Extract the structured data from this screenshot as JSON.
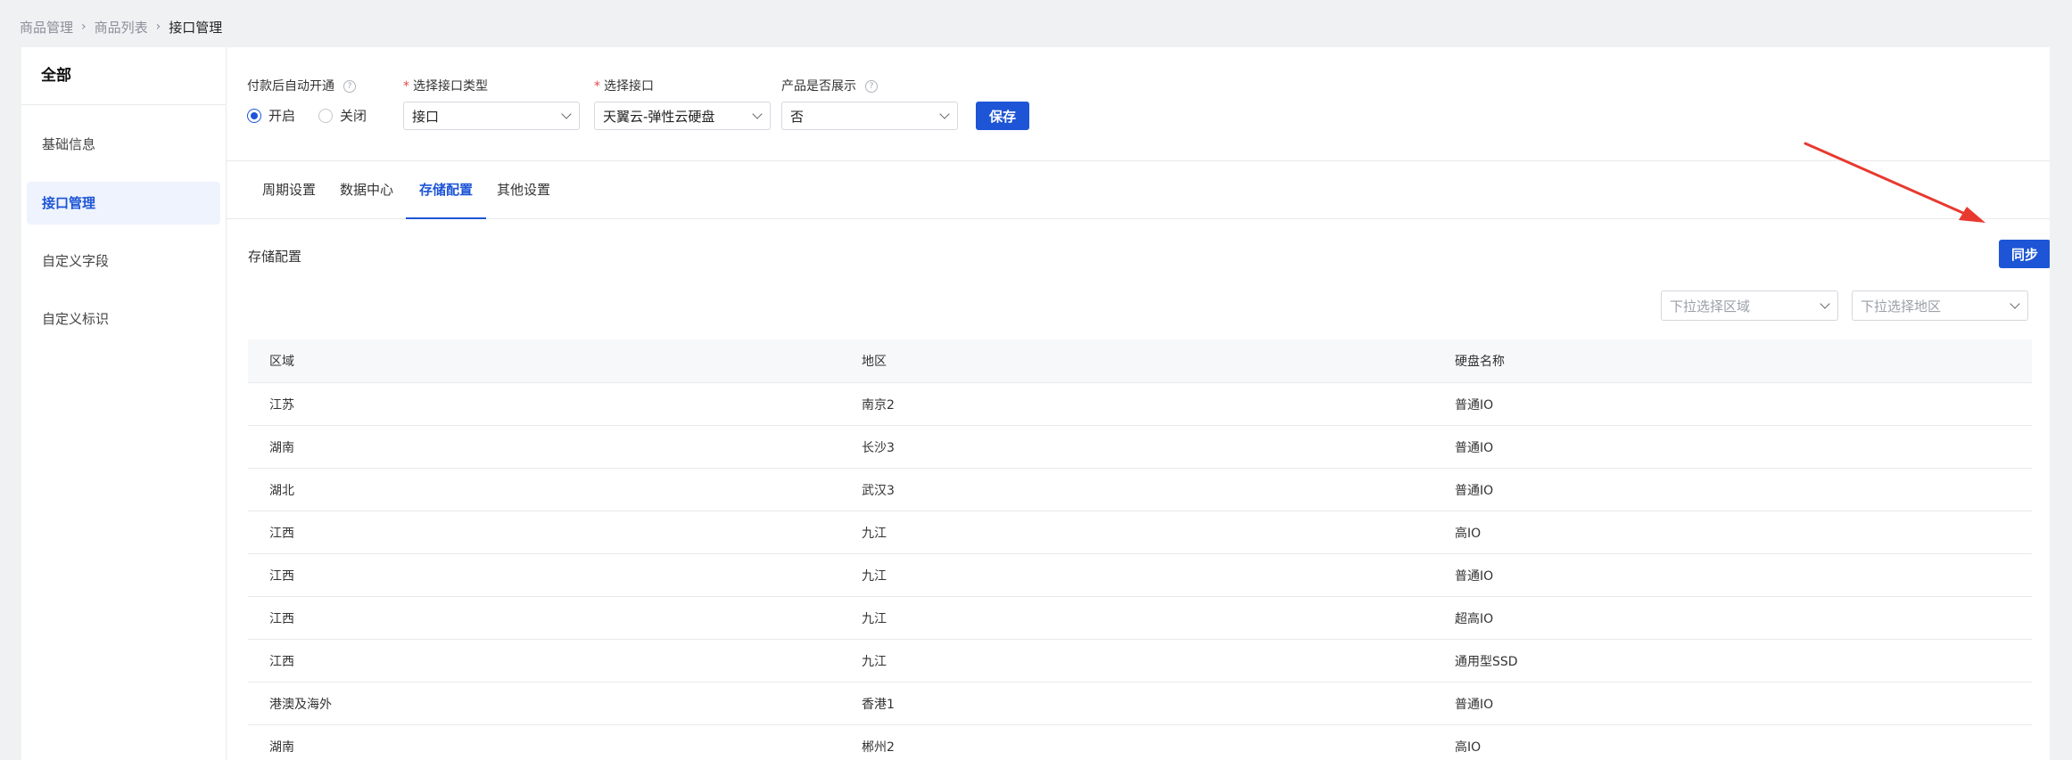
{
  "breadcrumb": {
    "items": [
      "商品管理",
      "商品列表"
    ],
    "current": "接口管理"
  },
  "sidebar": {
    "title": "全部",
    "items": [
      {
        "label": "基础信息",
        "active": false
      },
      {
        "label": "接口管理",
        "active": true
      },
      {
        "label": "自定义字段",
        "active": false
      },
      {
        "label": "自定义标识",
        "active": false
      }
    ]
  },
  "form": {
    "auto_open": {
      "label": "付款后自动开通",
      "options": [
        "开启",
        "关闭"
      ],
      "selected": "开启"
    },
    "interface_type": {
      "label": "选择接口类型",
      "value": "接口"
    },
    "interface": {
      "label": "选择接口",
      "value": "天翼云-弹性云硬盘"
    },
    "product_display": {
      "label": "产品是否展示",
      "value": "否"
    },
    "save_label": "保存",
    "help_glyph": "?"
  },
  "tabs": [
    "周期设置",
    "数据中心",
    "存储配置",
    "其他设置"
  ],
  "active_tab": "存储配置",
  "storage": {
    "title": "存储配置",
    "sync_label": "同步",
    "filter_region_placeholder": "下拉选择区域",
    "filter_area_placeholder": "下拉选择地区"
  },
  "table": {
    "columns": [
      "区域",
      "地区",
      "硬盘名称"
    ],
    "rows": [
      [
        "江苏",
        "南京2",
        "普通IO"
      ],
      [
        "湖南",
        "长沙3",
        "普通IO"
      ],
      [
        "湖北",
        "武汉3",
        "普通IO"
      ],
      [
        "江西",
        "九江",
        "高IO"
      ],
      [
        "江西",
        "九江",
        "普通IO"
      ],
      [
        "江西",
        "九江",
        "超高IO"
      ],
      [
        "江西",
        "九江",
        "通用型SSD"
      ],
      [
        "港澳及海外",
        "香港1",
        "普通IO"
      ],
      [
        "湖南",
        "郴州2",
        "高IO"
      ]
    ]
  },
  "colors": {
    "primary": "#1d55d6",
    "arrow": "#e8392f",
    "required": "#e5484d"
  },
  "annotation_icon": "red-arrow-icon"
}
